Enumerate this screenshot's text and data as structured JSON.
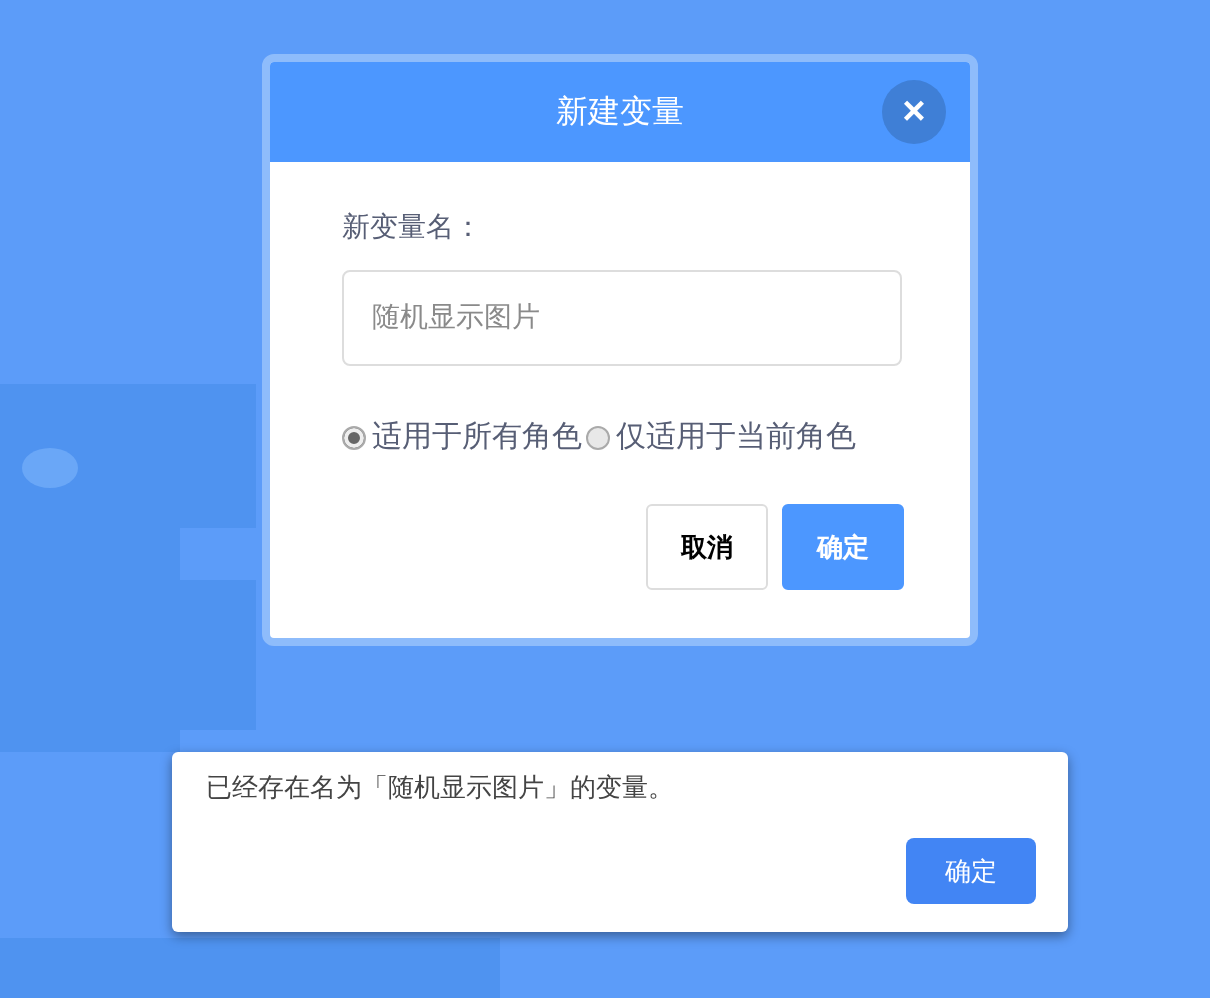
{
  "dialog": {
    "title": "新建变量",
    "close": "×",
    "name_label": "新变量名：",
    "name_field": {
      "value": "随机显示图片"
    },
    "scopes": [
      {
        "label": "适用于所有角色",
        "selected": true
      },
      {
        "label": "仅适用于当前角色",
        "selected": false
      }
    ],
    "buttons": [
      {
        "label": "取消",
        "kind": "secondary"
      },
      {
        "label": "确定",
        "kind": "primary"
      }
    ]
  },
  "alert": {
    "message": "已经存在名为「随机显示图片」的变量。",
    "button": "确定"
  }
}
